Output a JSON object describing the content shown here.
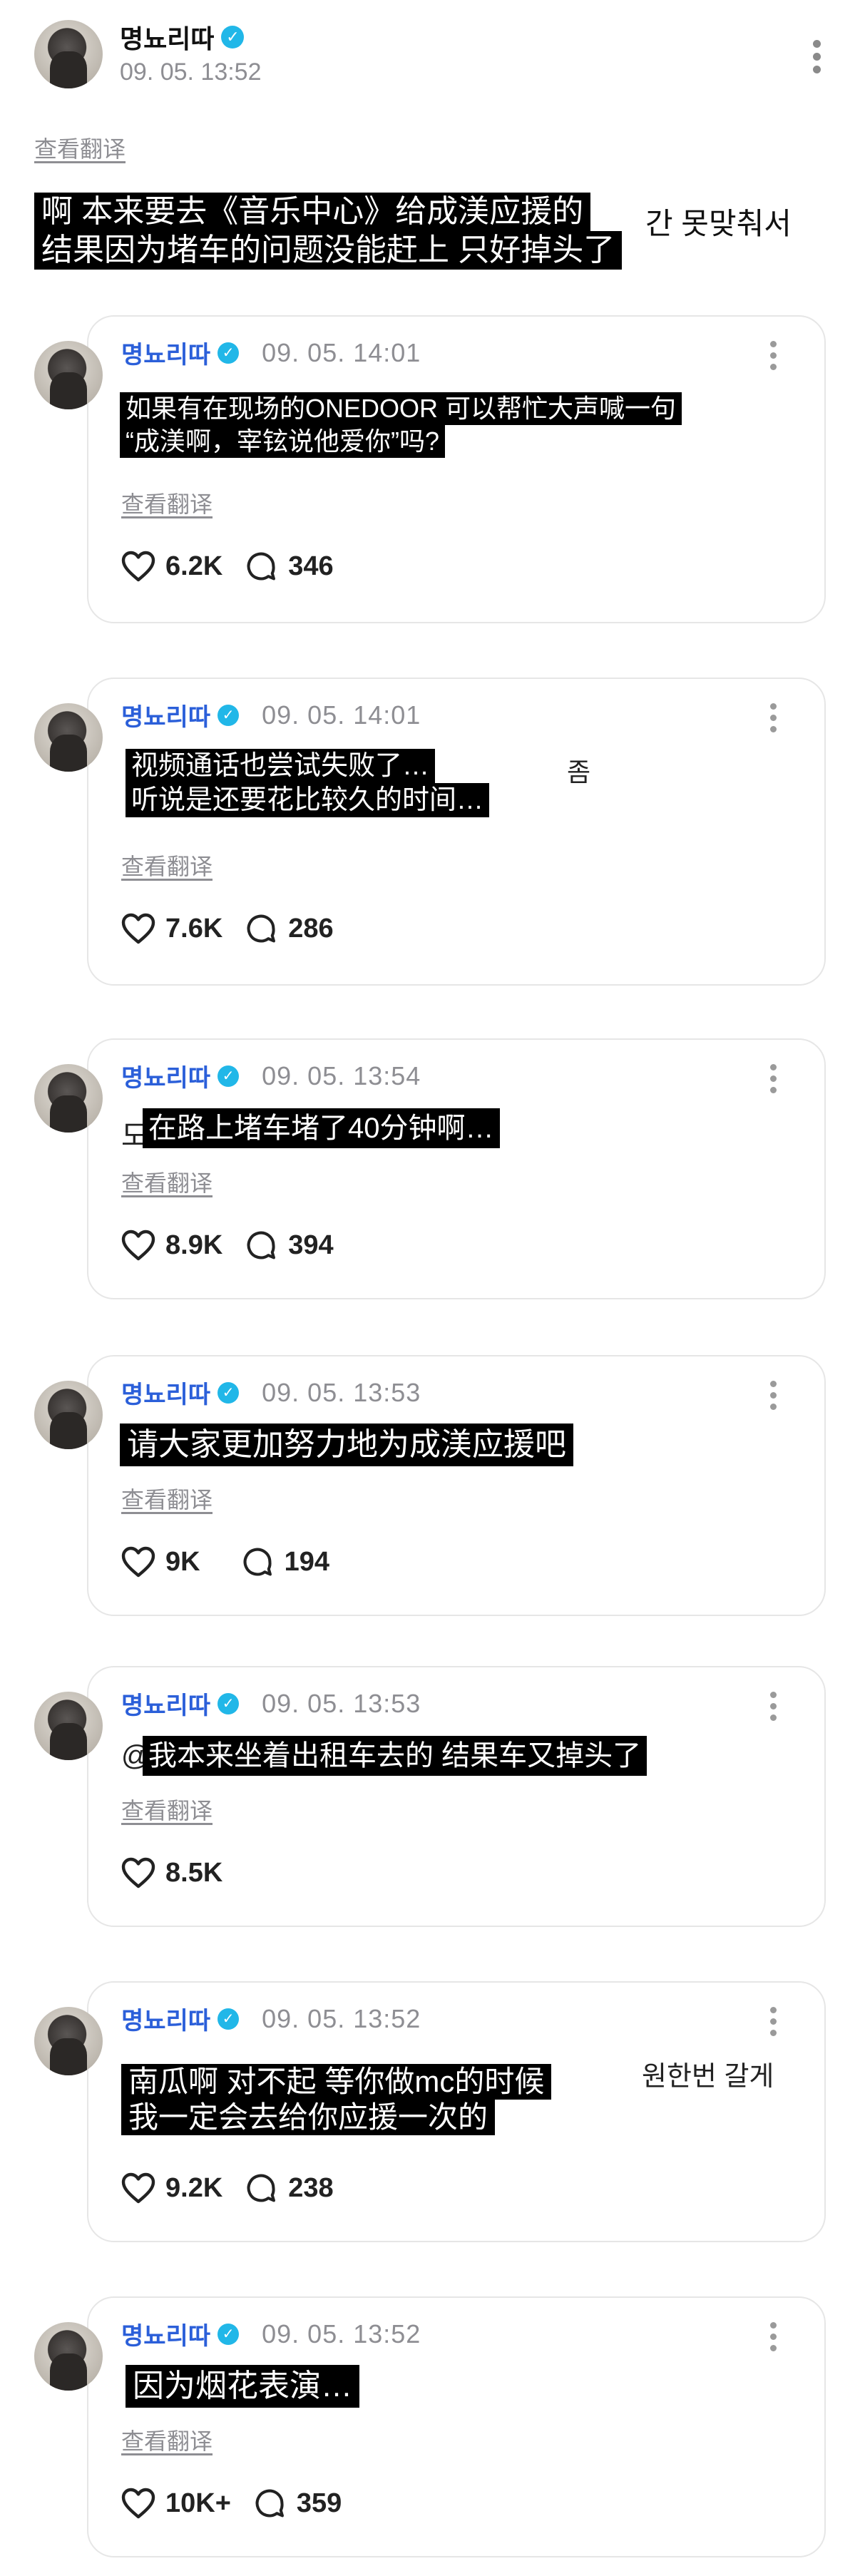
{
  "main": {
    "username": "명뇨리따",
    "timestamp": "09. 05. 13:52",
    "translate_label": "查看翻译",
    "overlay_lines": [
      "啊 本来要去《音乐中心》给成渼应援的",
      "结果因为堵车的问题没能赶上 只好掉头了"
    ],
    "bg_korean_right": "간 못맞춰서"
  },
  "replies": [
    {
      "username": "명뇨리따",
      "timestamp": "09. 05. 14:01",
      "overlay_lines": [
        "如果有在现场的ONEDOOR 可以帮忙大声喊一句",
        "“成渼啊，宰铉说他爱你”吗?"
      ],
      "translate_label": "查看翻译",
      "likes": "6.2K",
      "comments": "346"
    },
    {
      "username": "명뇨리따",
      "timestamp": "09. 05. 14:01",
      "overlay_lines": [
        "视频通话也尝试失败了…",
        "听说是还要花比较久的时间…"
      ],
      "bg_korean_right": "좀",
      "translate_label": "查看翻译",
      "likes": "7.6K",
      "comments": "286"
    },
    {
      "username": "명뇨리따",
      "timestamp": "09. 05. 13:54",
      "overlay_lines": [
        "在路上堵车堵了40分钟啊…"
      ],
      "bg_korean_left": "도",
      "translate_label": "查看翻译",
      "likes": "8.9K",
      "comments": "394"
    },
    {
      "username": "명뇨리따",
      "timestamp": "09. 05. 13:53",
      "overlay_lines": [
        "请大家更加努力地为成渼应援吧"
      ],
      "translate_label": "查看翻译",
      "likes": "9K",
      "comments": "194"
    },
    {
      "username": "명뇨리따",
      "timestamp": "09. 05. 13:53",
      "overlay_lines": [
        "我本来坐着出租车去的 结果车又掉头了"
      ],
      "bg_korean_left": "@",
      "translate_label": "查看翻译",
      "likes": "8.5K"
    },
    {
      "username": "명뇨리따",
      "timestamp": "09. 05. 13:52",
      "overlay_lines": [
        "南瓜啊 对不起 等你做mc的时候",
        "我一定会去给你应援一次的"
      ],
      "bg_korean_right": "원한번 갈게",
      "likes": "9.2K",
      "comments": "238"
    },
    {
      "username": "명뇨리따",
      "timestamp": "09. 05. 13:52",
      "overlay_lines": [
        "因为烟花表演…"
      ],
      "translate_label": "查看翻译",
      "likes": "10K+",
      "comments": "359"
    }
  ],
  "icons": {
    "verified": "verified-badge-icon",
    "more": "more-options-icon",
    "like": "heart-icon",
    "comment": "comment-bubble-icon"
  },
  "colors": {
    "verified": "#21b7e8",
    "reply_username": "#2b5fd9",
    "muted": "#8e8e93",
    "overlay_bg": "#000000"
  }
}
